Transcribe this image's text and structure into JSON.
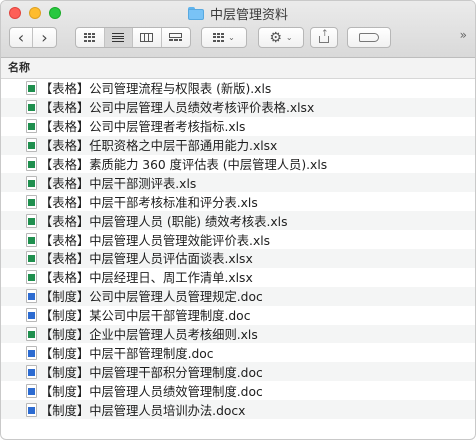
{
  "window": {
    "title": "中层管理资料",
    "folder_icon": "folder-icon"
  },
  "toolbar": {
    "back_icon": "chevron-left-icon",
    "forward_icon": "chevron-right-icon",
    "view_modes": [
      "icon-view-icon",
      "list-view-icon",
      "column-view-icon",
      "gallery-view-icon"
    ],
    "active_view": "list",
    "group_icon": "arrange-icon",
    "action_icon": "gear-icon",
    "share_icon": "share-icon",
    "tags_icon": "tag-icon",
    "back_glyph": "‹",
    "forward_glyph": "›",
    "chevron_glyph": "⌄",
    "more_glyph": "»"
  },
  "list": {
    "header": "名称",
    "files": [
      {
        "name": "【表格】公司管理流程与权限表 (新版).xls",
        "type": "xls"
      },
      {
        "name": "【表格】公司中层管理人员绩效考核评价表格.xlsx",
        "type": "xls"
      },
      {
        "name": "【表格】公司中层管理者考核指标.xls",
        "type": "xls"
      },
      {
        "name": "【表格】任职资格之中层干部通用能力.xlsx",
        "type": "xls"
      },
      {
        "name": "【表格】素质能力 360 度评估表 (中层管理人员).xls",
        "type": "xls"
      },
      {
        "name": "【表格】中层干部测评表.xls",
        "type": "xls"
      },
      {
        "name": "【表格】中层干部考核标准和评分表.xls",
        "type": "xls"
      },
      {
        "name": "【表格】中层管理人员 (职能) 绩效考核表.xls",
        "type": "xls"
      },
      {
        "name": "【表格】中层管理人员管理效能评价表.xls",
        "type": "xls"
      },
      {
        "name": "【表格】中层管理人员评估面谈表.xlsx",
        "type": "xls"
      },
      {
        "name": "【表格】中层经理日、周工作清单.xlsx",
        "type": "xls"
      },
      {
        "name": "【制度】公司中层管理人员管理规定.doc",
        "type": "doc"
      },
      {
        "name": "【制度】某公司中层干部管理制度.doc",
        "type": "doc"
      },
      {
        "name": "【制度】企业中层管理人员考核细则.xls",
        "type": "xls"
      },
      {
        "name": "【制度】中层干部管理制度.doc",
        "type": "doc"
      },
      {
        "name": "【制度】中层管理干部积分管理制度.doc",
        "type": "doc"
      },
      {
        "name": "【制度】中层管理人员绩效管理制度.doc",
        "type": "doc"
      },
      {
        "name": "【制度】中层管理人员培训办法.docx",
        "type": "doc"
      }
    ]
  },
  "colors": {
    "close": "#fe5f57",
    "minimize": "#febc2e",
    "maximize": "#28c840",
    "spreadsheet_badge": "#1f8f4e",
    "document_badge": "#2c6bd1"
  }
}
